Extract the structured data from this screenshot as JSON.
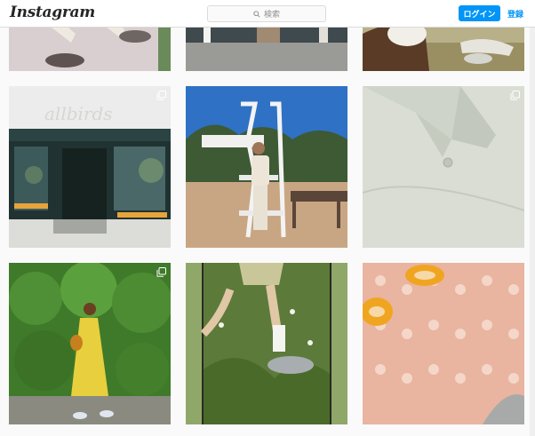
{
  "header": {
    "logo_text": "Instagram",
    "search_placeholder": "検索",
    "login_label": "ログイン",
    "signup_label": "登録"
  },
  "colors": {
    "accent": "#0095f6",
    "border": "#dbdbdb",
    "background": "#fafafa"
  },
  "posts": [
    {
      "row": 1,
      "col": 1,
      "content": "photo-legs-shoes",
      "multi": false
    },
    {
      "row": 1,
      "col": 2,
      "content": "photo-storefront-sidewalk",
      "multi": false
    },
    {
      "row": 1,
      "col": 3,
      "content": "photo-dog-grass",
      "multi": false
    },
    {
      "row": 2,
      "col": 1,
      "content": "photo-allbirds-store",
      "multi": true,
      "sign_text": "allbirds"
    },
    {
      "row": 2,
      "col": 2,
      "content": "photo-lifeguard-tower",
      "multi": false
    },
    {
      "row": 2,
      "col": 3,
      "content": "photo-linen-shirt",
      "multi": true
    },
    {
      "row": 3,
      "col": 1,
      "content": "photo-yellow-dress",
      "multi": true
    },
    {
      "row": 3,
      "col": 2,
      "content": "photo-sneaker-field",
      "multi": false
    },
    {
      "row": 3,
      "col": 3,
      "content": "photo-knit-shoe-closeup",
      "multi": false
    }
  ]
}
